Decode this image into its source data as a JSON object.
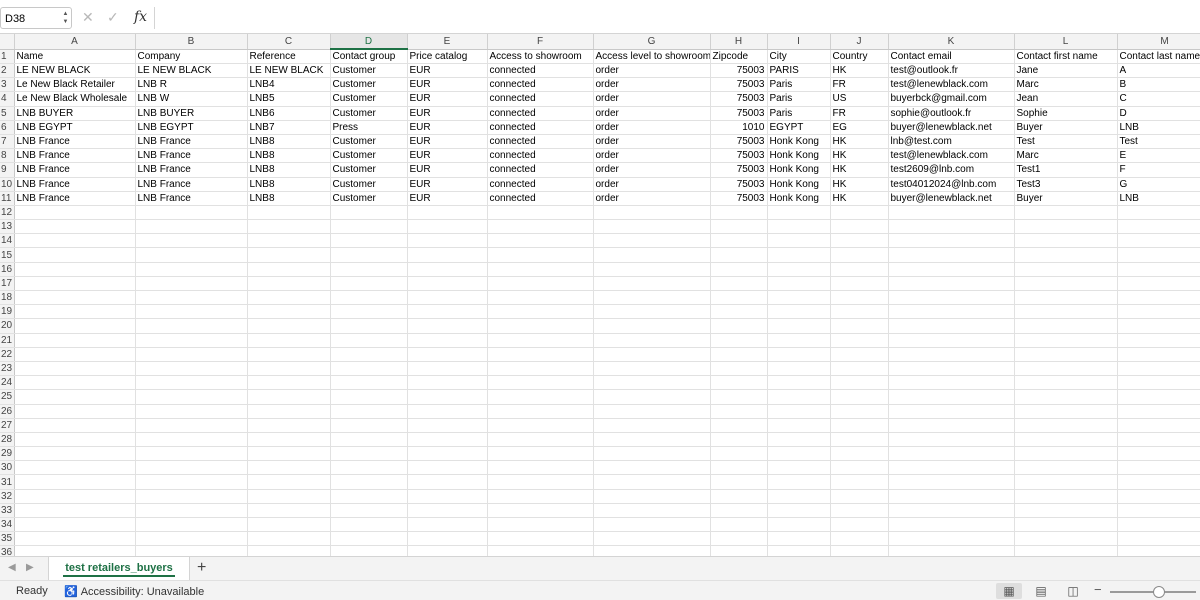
{
  "formula_bar": {
    "cell_ref": "D38",
    "cancel_icon": "close-icon",
    "confirm_icon": "check-icon",
    "fx_label": "fx",
    "formula": ""
  },
  "columns": [
    "A",
    "B",
    "C",
    "D",
    "E",
    "F",
    "G",
    "H",
    "I",
    "J",
    "K",
    "L",
    "M"
  ],
  "active_column": "D",
  "header_row": [
    "Name",
    "Company",
    "Reference",
    "Contact group",
    "Price catalog",
    "Access to showroom",
    "Access level to showroom",
    "Zipcode",
    "City",
    "Country",
    "Contact email",
    "Contact first name",
    "Contact last name"
  ],
  "rows": [
    [
      "LE NEW BLACK",
      "LE NEW BLACK",
      "LE NEW BLACK",
      "Customer",
      "EUR",
      "connected",
      "order",
      "75003",
      "PARIS",
      "HK",
      "test@outlook.fr",
      "Jane",
      "A"
    ],
    [
      "Le New Black Retailer",
      "LNB R",
      "LNB4",
      "Customer",
      "EUR",
      "connected",
      "order",
      "75003",
      "Paris",
      "FR",
      "test@lenewblack.com",
      "Marc",
      "B"
    ],
    [
      "Le New Black Wholesale",
      "LNB W",
      "LNB5",
      "Customer",
      "EUR",
      "connected",
      "order",
      "75003",
      "Paris",
      "US",
      "buyerbck@gmail.com",
      "Jean",
      "C"
    ],
    [
      "LNB BUYER",
      "LNB BUYER",
      "LNB6",
      "Customer",
      "EUR",
      "connected",
      "order",
      "75003",
      "Paris",
      "FR",
      "sophie@outlook.fr",
      "Sophie",
      "D"
    ],
    [
      "LNB EGYPT",
      "LNB EGYPT",
      "LNB7",
      "Press",
      "EUR",
      "connected",
      "order",
      "1010",
      "EGYPT",
      "EG",
      "buyer@lenewblack.net",
      "Buyer",
      "LNB"
    ],
    [
      "LNB France",
      "LNB France",
      "LNB8",
      "Customer",
      "EUR",
      "connected",
      "order",
      "75003",
      "Honk Kong",
      "HK",
      "lnb@test.com",
      "Test",
      "Test"
    ],
    [
      "LNB France",
      "LNB France",
      "LNB8",
      "Customer",
      "EUR",
      "connected",
      "order",
      "75003",
      "Honk Kong",
      "HK",
      "test@lenewblack.com",
      "Marc",
      "E"
    ],
    [
      "LNB France",
      "LNB France",
      "LNB8",
      "Customer",
      "EUR",
      "connected",
      "order",
      "75003",
      "Honk Kong",
      "HK",
      "test2609@lnb.com",
      "Test1",
      "F"
    ],
    [
      "LNB France",
      "LNB France",
      "LNB8",
      "Customer",
      "EUR",
      "connected",
      "order",
      "75003",
      "Honk Kong",
      "HK",
      "test04012024@lnb.com",
      "Test3",
      "G"
    ],
    [
      "LNB France",
      "LNB France",
      "LNB8",
      "Customer",
      "EUR",
      "connected",
      "order",
      "75003",
      "Honk Kong",
      "HK",
      "buyer@lenewblack.net",
      "Buyer",
      "LNB"
    ]
  ],
  "row_numbers": [
    "1",
    "2",
    "3",
    "4",
    "5",
    "6",
    "7",
    "8",
    "9",
    "10",
    "11",
    "12",
    "13",
    "14",
    "15",
    "16",
    "17",
    "18",
    "19",
    "20",
    "21",
    "22",
    "23",
    "24",
    "25",
    "26",
    "27",
    "28",
    "29",
    "30",
    "31",
    "32",
    "33",
    "34",
    "35",
    "36"
  ],
  "sheet_tabs": {
    "prev_icon": "chevron-left-icon",
    "next_icon": "chevron-right-icon",
    "active_sheet": "test retailers_buyers",
    "add_icon": "plus-icon"
  },
  "status_bar": {
    "ready": "Ready",
    "accessibility": "Accessibility: Unavailable",
    "views": [
      "normal-view-icon",
      "page-layout-view-icon",
      "page-break-view-icon"
    ],
    "zoom_percent": 57
  },
  "colors": {
    "accent": "#1e7145",
    "header_bg": "#f3f3f3",
    "gridline": "#e1e1e1"
  }
}
